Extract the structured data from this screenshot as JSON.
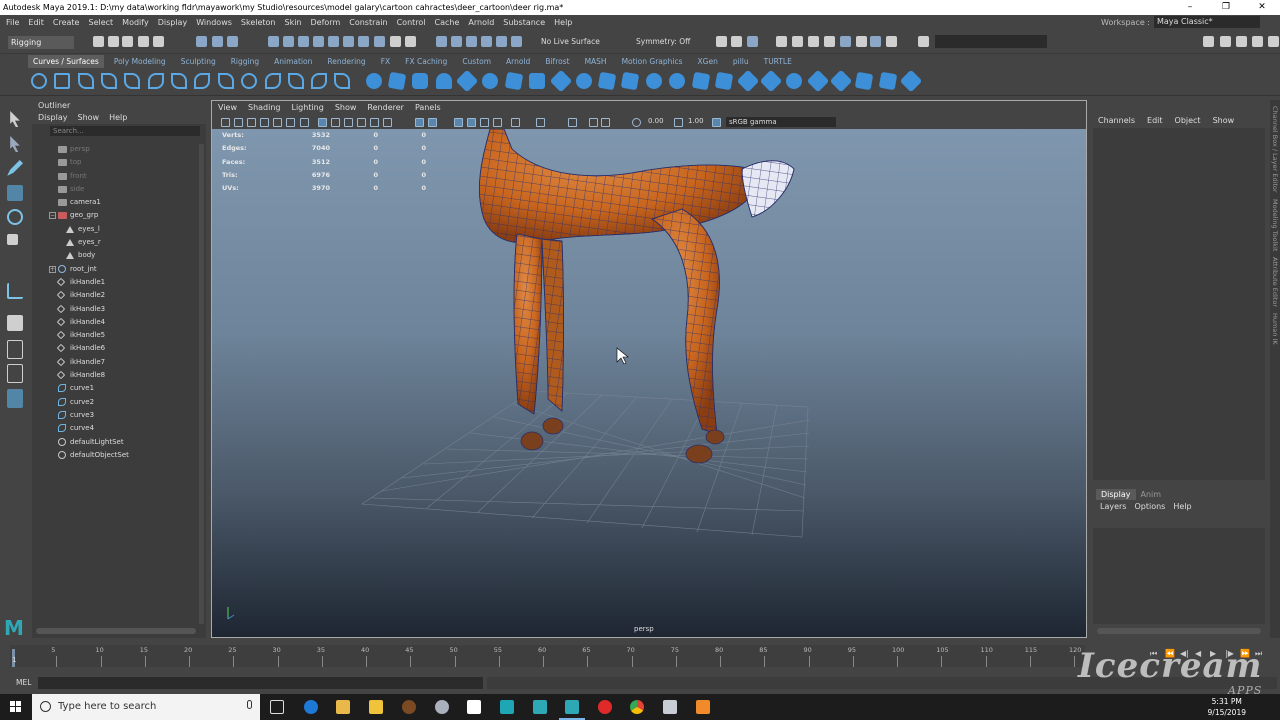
{
  "window": {
    "title": "Autodesk Maya 2019.1: D:\\my data\\working fldr\\mayawork\\my Studio\\resources\\model galary\\cartoon cahractes\\deer_cartoon\\deer rig.ma*",
    "controls": [
      "–",
      "❐",
      "✕"
    ]
  },
  "menubar": [
    "File",
    "Edit",
    "Create",
    "Select",
    "Modify",
    "Display",
    "Windows",
    "Skeleton",
    "Skin",
    "Deform",
    "Constrain",
    "Control",
    "Cache",
    "Arnold",
    "Substance",
    "Help"
  ],
  "workspace": {
    "label": "Workspace :",
    "value": "Maya Classic*"
  },
  "statusline": {
    "mode": "Rigging",
    "live_surface": "No Live Surface",
    "symmetry": "Symmetry: Off"
  },
  "shelf_tabs": [
    "Curves / Surfaces",
    "Poly Modeling",
    "Sculpting",
    "Rigging",
    "Animation",
    "Rendering",
    "FX",
    "FX Caching",
    "Custom",
    "Arnold",
    "Bifrost",
    "MASH",
    "Motion Graphics",
    "XGen",
    "pillu",
    "TURTLE"
  ],
  "outliner": {
    "title": "Outliner",
    "menus": [
      "Display",
      "Show",
      "Help"
    ],
    "search_placeholder": "Search...",
    "items": [
      {
        "label": "persp",
        "icon": "camera-icon",
        "dim": true,
        "indent": 1
      },
      {
        "label": "top",
        "icon": "camera-icon",
        "dim": true,
        "indent": 1
      },
      {
        "label": "front",
        "icon": "camera-icon",
        "dim": true,
        "indent": 1
      },
      {
        "label": "side",
        "icon": "camera-icon",
        "dim": true,
        "indent": 1
      },
      {
        "label": "camera1",
        "icon": "camera-icon",
        "dim": false,
        "indent": 1
      },
      {
        "label": "geo_grp",
        "icon": "group-icon",
        "dim": false,
        "indent": 1,
        "expander": "−"
      },
      {
        "label": "eyes_l",
        "icon": "mesh-icon",
        "dim": false,
        "indent": 2
      },
      {
        "label": "eyes_r",
        "icon": "mesh-icon",
        "dim": false,
        "indent": 2
      },
      {
        "label": "body",
        "icon": "mesh-icon",
        "dim": false,
        "indent": 2
      },
      {
        "label": "root_jnt",
        "icon": "joint-icon",
        "dim": false,
        "indent": 1,
        "expander": "+"
      },
      {
        "label": "ikHandle1",
        "icon": "ikhandle-icon",
        "dim": false,
        "indent": 1
      },
      {
        "label": "ikHandle2",
        "icon": "ikhandle-icon",
        "dim": false,
        "indent": 1
      },
      {
        "label": "ikHandle3",
        "icon": "ikhandle-icon",
        "dim": false,
        "indent": 1
      },
      {
        "label": "ikHandle4",
        "icon": "ikhandle-icon",
        "dim": false,
        "indent": 1
      },
      {
        "label": "ikHandle5",
        "icon": "ikhandle-icon",
        "dim": false,
        "indent": 1
      },
      {
        "label": "ikHandle6",
        "icon": "ikhandle-icon",
        "dim": false,
        "indent": 1
      },
      {
        "label": "ikHandle7",
        "icon": "ikhandle-icon",
        "dim": false,
        "indent": 1
      },
      {
        "label": "ikHandle8",
        "icon": "ikhandle-icon",
        "dim": false,
        "indent": 1
      },
      {
        "label": "curve1",
        "icon": "curve-icon",
        "dim": false,
        "indent": 1
      },
      {
        "label": "curve2",
        "icon": "curve-icon",
        "dim": false,
        "indent": 1
      },
      {
        "label": "curve3",
        "icon": "curve-icon",
        "dim": false,
        "indent": 1
      },
      {
        "label": "curve4",
        "icon": "curve-icon",
        "dim": false,
        "indent": 1
      },
      {
        "label": "defaultLightSet",
        "icon": "set-icon",
        "dim": false,
        "indent": 1
      },
      {
        "label": "defaultObjectSet",
        "icon": "set-icon",
        "dim": false,
        "indent": 1
      }
    ]
  },
  "viewport": {
    "menus": [
      "View",
      "Shading",
      "Lighting",
      "Show",
      "Renderer",
      "Panels"
    ],
    "exposure": "0.00",
    "gamma_value": "1.00",
    "color_space": "sRGB gamma",
    "camera": "persp",
    "hud": [
      {
        "label": "Verts:",
        "value": "3532",
        "a": "0",
        "b": "0"
      },
      {
        "label": "Edges:",
        "value": "7040",
        "a": "0",
        "b": "0"
      },
      {
        "label": "Faces:",
        "value": "3512",
        "a": "0",
        "b": "0"
      },
      {
        "label": "Tris:",
        "value": "6976",
        "a": "0",
        "b": "0"
      },
      {
        "label": "UVs:",
        "value": "3970",
        "a": "0",
        "b": "0"
      }
    ],
    "model_color": "#c8651e",
    "wire_color": "#2b2f6a"
  },
  "channelbox": {
    "menus": [
      "Channels",
      "Edit",
      "Object",
      "Show"
    ],
    "tabs": [
      "Display",
      "Anim"
    ],
    "layer_menus": [
      "Layers",
      "Options",
      "Help"
    ],
    "side_tabs": [
      "Channel Box / Layer Editor",
      "Modeling Toolkit",
      "Attribute Editor",
      "Human IK"
    ]
  },
  "timeslider": {
    "current_frame": "1",
    "ticks": [
      "5",
      "10",
      "15",
      "20",
      "25",
      "30",
      "35",
      "40",
      "45",
      "50",
      "55",
      "60",
      "65",
      "70",
      "75",
      "80",
      "85",
      "90",
      "95",
      "100",
      "105",
      "110",
      "115",
      "120"
    ],
    "start_label": "1"
  },
  "cmdline": {
    "label": "MEL"
  },
  "taskbar": {
    "search_placeholder": "Type here to search",
    "time": "5:31 PM",
    "date": "9/15/2019"
  },
  "watermark": {
    "text": "Icecream",
    "sub": "APPS"
  }
}
